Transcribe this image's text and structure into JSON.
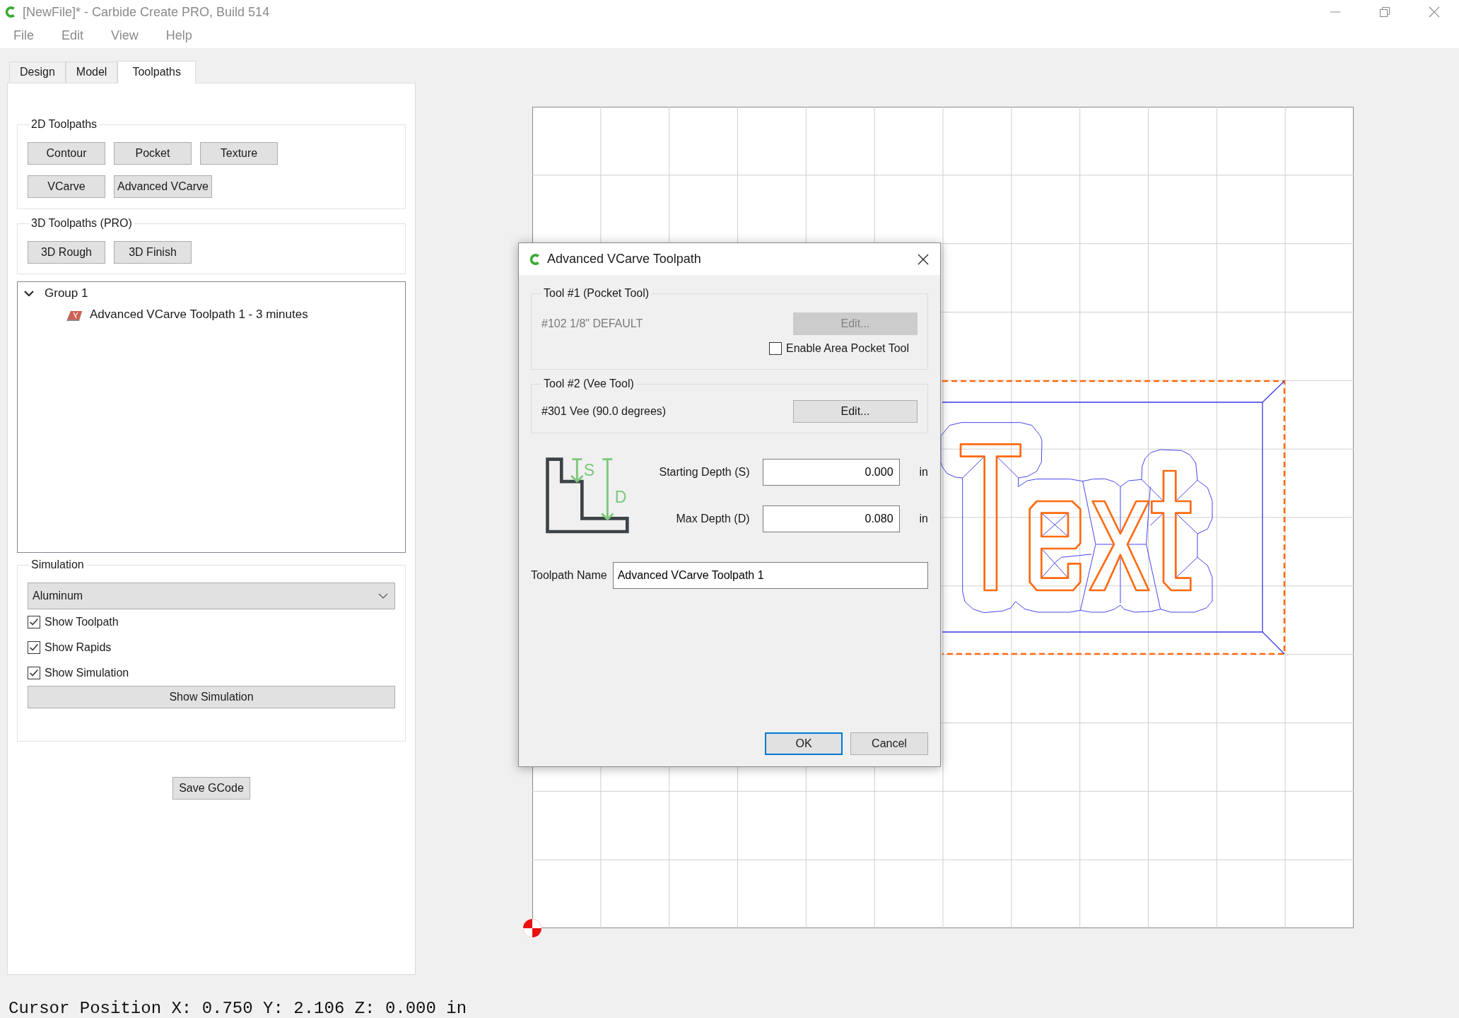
{
  "window": {
    "title": "[NewFile]* - Carbide Create PRO, Build 514"
  },
  "menu": [
    "File",
    "Edit",
    "View",
    "Help"
  ],
  "tabs": [
    {
      "label": "Design",
      "selected": false
    },
    {
      "label": "Model",
      "selected": false
    },
    {
      "label": "Toolpaths",
      "selected": true
    }
  ],
  "toolpaths_2d": {
    "title": "2D Toolpaths",
    "buttons": [
      "Contour",
      "Pocket",
      "Texture",
      "VCarve",
      "Advanced VCarve"
    ]
  },
  "toolpaths_3d": {
    "title": "3D Toolpaths (PRO)",
    "buttons": [
      "3D Rough",
      "3D Finish"
    ]
  },
  "toolpath_tree": [
    {
      "label": "Group 1",
      "expanded": true,
      "children": [
        {
          "label": "Advanced VCarve Toolpath 1 - 3 minutes"
        }
      ]
    }
  ],
  "simulation": {
    "title": "Simulation",
    "material": "Aluminum",
    "options": [
      {
        "label": "Show Toolpath",
        "checked": true
      },
      {
        "label": "Show Rapids",
        "checked": true
      },
      {
        "label": "Show Simulation",
        "checked": true
      }
    ],
    "button": "Show Simulation"
  },
  "save_button": "Save GCode",
  "dialog": {
    "title": "Advanced VCarve Toolpath",
    "tool_1": {
      "title": "Tool #1 (Pocket Tool)",
      "tool": "#102 1/8\" DEFAULT",
      "edit_button": "Edit...",
      "disabled": true,
      "enable_option": {
        "label": "Enable Area Pocket Tool",
        "checked": false
      }
    },
    "tool_2": {
      "title": "Tool #2 (Vee Tool)",
      "tool": "#301 Vee (90.0 degrees)",
      "edit_button": "Edit...",
      "disabled": false
    },
    "diagram_labels": [
      "S",
      "D"
    ],
    "depth_fields": [
      {
        "label": "Starting Depth (S)",
        "value": "0.000",
        "unit": "in"
      },
      {
        "label": "Max Depth (D)",
        "value": "0.080",
        "unit": "in"
      }
    ],
    "toolpath_name": {
      "label": "Toolpath Name",
      "value": "Advanced VCarve Toolpath 1"
    },
    "buttons": [
      {
        "label": "OK",
        "default": true
      },
      {
        "label": "Cancel",
        "default": false
      }
    ]
  },
  "status_bar": "Cursor Position X: 0.750 Y: 2.106 Z: 0.000 in"
}
